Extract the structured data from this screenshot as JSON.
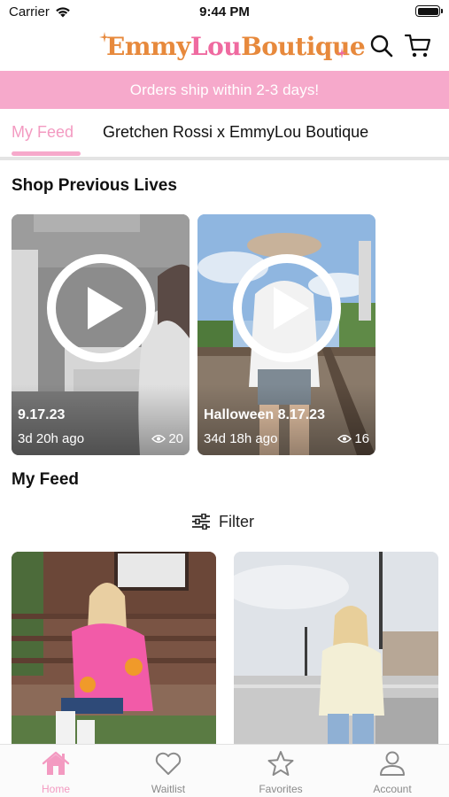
{
  "status_bar": {
    "carrier": "Carrier",
    "time": "9:44 PM"
  },
  "header": {
    "logo_text_part1": "Emmy",
    "logo_text_part2": "Lou",
    "logo_text_part3": "Boutique",
    "icons": [
      "search-icon",
      "cart-icon"
    ],
    "brand_colors": {
      "orange": "#e7893c",
      "pink": "#ef6aa0"
    }
  },
  "banner": {
    "text": "Orders ship within 2-3 days!",
    "color": "#f6a9cb"
  },
  "tabs": [
    {
      "label": "My Feed",
      "active": true
    },
    {
      "label": "Gretchen Rossi x EmmyLou Boutique",
      "active": false
    }
  ],
  "previous_lives": {
    "title": "Shop Previous Lives",
    "items": [
      {
        "title": "9.17.23",
        "time_ago": "3d 20h ago",
        "views": "20"
      },
      {
        "title": "Halloween 8.17.23",
        "time_ago": "34d 18h ago",
        "views": "16"
      }
    ]
  },
  "feed": {
    "title": "My Feed",
    "filter_label": "Filter"
  },
  "bottom_nav": [
    {
      "label": "Home",
      "icon": "home-icon",
      "active": true
    },
    {
      "label": "Waitlist",
      "icon": "heart-icon",
      "active": false
    },
    {
      "label": "Favorites",
      "icon": "star-icon",
      "active": false
    },
    {
      "label": "Account",
      "icon": "person-icon",
      "active": false
    }
  ],
  "accent_color": "#f39ac1"
}
